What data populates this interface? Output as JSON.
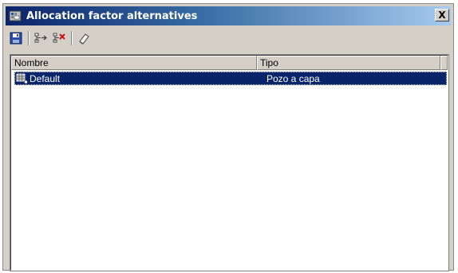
{
  "window": {
    "title": "Allocation factor alternatives",
    "close_label": "X"
  },
  "toolbar": {
    "buttons": [
      {
        "name": "save",
        "icon": "floppy-disk-icon"
      },
      {
        "name": "add-alternative",
        "icon": "tree-add-icon"
      },
      {
        "name": "delete-alternative",
        "icon": "tree-delete-icon"
      },
      {
        "name": "edit",
        "icon": "eraser-icon"
      }
    ]
  },
  "list": {
    "columns": [
      "Nombre",
      "Tipo"
    ],
    "rows": [
      {
        "nombre": "Default",
        "tipo": "Pozo a capa",
        "selected": true
      }
    ]
  },
  "colors": {
    "selection": "#0a246a",
    "titlebar_start": "#0a246a",
    "titlebar_end": "#a6caf0",
    "chrome": "#d4d0c8"
  }
}
